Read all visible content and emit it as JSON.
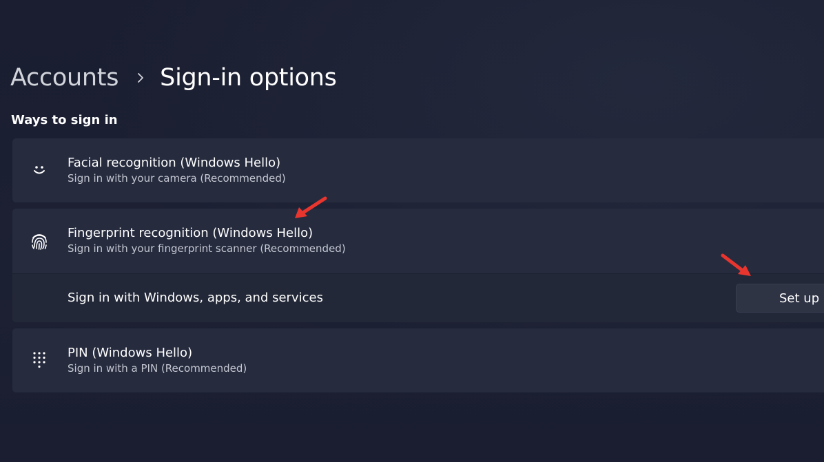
{
  "breadcrumb": {
    "parent": "Accounts",
    "current": "Sign-in options"
  },
  "section": {
    "title": "Ways to sign in"
  },
  "options": {
    "facial": {
      "title": "Facial recognition (Windows Hello)",
      "subtitle": "Sign in with your camera (Recommended)",
      "icon": "smiley-face-icon"
    },
    "fingerprint": {
      "title": "Fingerprint recognition (Windows Hello)",
      "subtitle": "Sign in with your fingerprint scanner (Recommended)",
      "icon": "fingerprint-icon",
      "sub_setting": {
        "label": "Sign in with Windows, apps, and services",
        "button_label": "Set up"
      }
    },
    "pin": {
      "title": "PIN (Windows Hello)",
      "subtitle": "Sign in with a PIN (Recommended)",
      "icon": "keypad-icon"
    }
  },
  "colors": {
    "background": "#1b1f31",
    "card": "#262b3e",
    "annotation_arrow": "#e8362f"
  }
}
